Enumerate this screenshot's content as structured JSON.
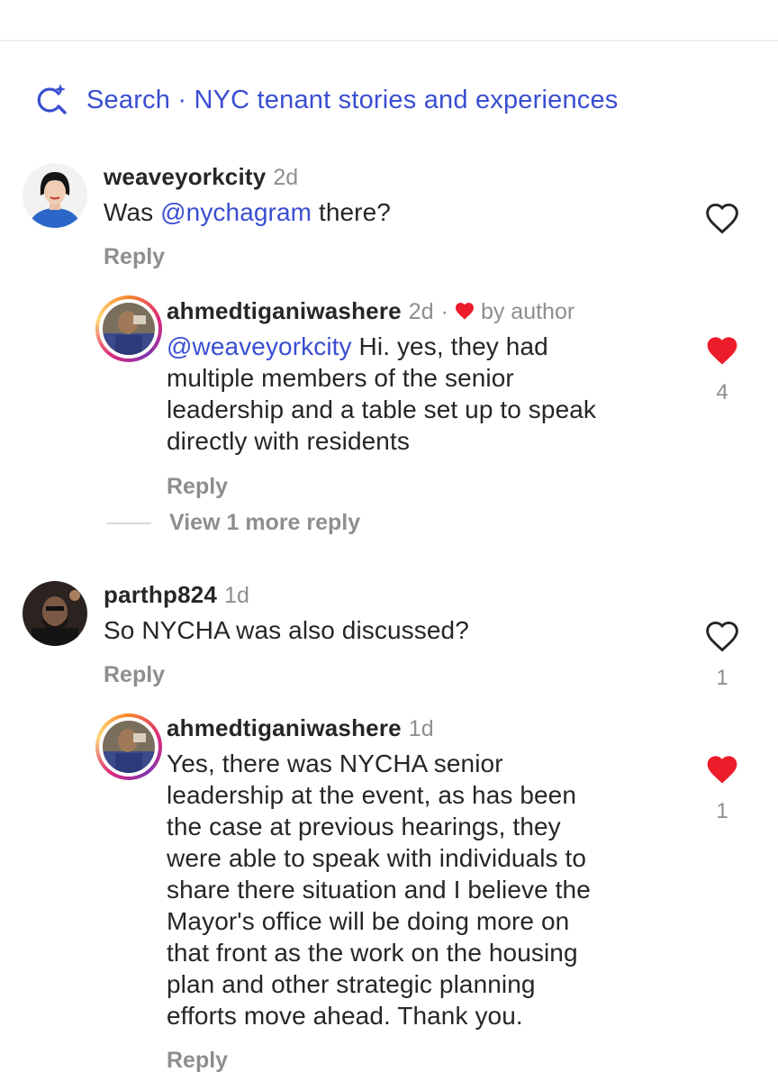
{
  "search": {
    "text": "Search · NYC tenant stories and experiences"
  },
  "comments": [
    {
      "username": "weaveyorkcity",
      "time": "2d",
      "mention": "@nychagram",
      "text_before": "Was ",
      "text_after": " there?",
      "reply_label": "Reply",
      "liked": false,
      "like_count": ""
    },
    {
      "username": "ahmedtiganiwashere",
      "time": "2d",
      "separator": "·",
      "by_author": "by author",
      "mention": "@weaveyorkcity",
      "line1_rest": " Hi. yes, they had",
      "lines": [
        "multiple members of the senior",
        "leadership and a table set up to speak",
        "directly with residents"
      ],
      "reply_label": "Reply",
      "liked": true,
      "like_count": "4"
    },
    {
      "username": "parthp824",
      "time": "1d",
      "text": "So NYCHA was also discussed?",
      "reply_label": "Reply",
      "liked": false,
      "like_count": "1"
    },
    {
      "username": "ahmedtiganiwashere",
      "time": "1d",
      "lines": [
        "Yes, there was NYCHA senior",
        "leadership at the event, as has been",
        "the case at previous hearings, they",
        "were able to speak with individuals to",
        "share there situation and I believe the",
        "Mayor's office will be doing more on",
        "that front as the work on the housing",
        "plan and other strategic planning",
        "efforts move ahead. Thank you."
      ],
      "reply_label": "Reply",
      "liked": true,
      "like_count": "1"
    }
  ],
  "view_more": {
    "label": "View 1 more reply"
  },
  "colors": {
    "link": "#3a4ed0",
    "secondary": "#8e8e8e",
    "heart": "#ed1c2b"
  },
  "icons": [
    "search-icon",
    "heart-outline-icon",
    "heart-filled-icon"
  ]
}
